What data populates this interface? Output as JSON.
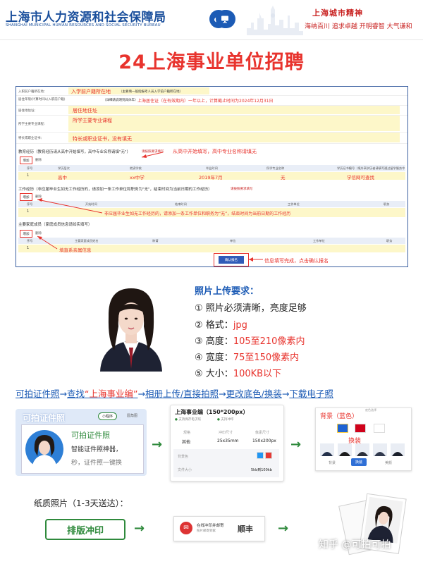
{
  "header": {
    "bureau_name": "上海市人力资源和社会保障局",
    "bureau_name_en": "SHANGHAI MUNICIPAL HUMAN RESOURCES AND SOCIAL SECURITY BUREAU",
    "weibo_icon": "weibo-icon",
    "computer_icon": "computer-icon",
    "spirit_title": "上海城市精神",
    "spirit_slogan": "海纳百川  追求卓越  开明睿智  大气谦和"
  },
  "main_title": "24上海事业单位招聘",
  "form": {
    "labels": {
      "row1": "入职前户籍所在地：",
      "row2": "居住年限(计算时间以入职前户籍)",
      "row3": "居住地住址：",
      "row4": "所学主要专业课程：",
      "row5": "特长或职业证书："
    },
    "hukou_note": "入学前户籍所在地",
    "hukou_small": "（主要填一般指报考人员入学前户籍所在地）",
    "residence_small": "（详细请说明到具体年）",
    "residence_note": "上海居住证（在有效期内）一年以上，计算截止时间为2024年12月31日",
    "address_value": "居住地住址",
    "courses_value": "所学主要专业课程",
    "skills_value": "特长或职业证书，没有填无",
    "education": {
      "heading": "教育经历（教育经历请从高中开始填写，高中专业名称请填\"无\"）",
      "tip": "请按照要求填写",
      "note": "从高中开始填写，高中专业名称请填无",
      "add": "增加",
      "delete": "删除",
      "headers": [
        "序号",
        "学历层次",
        "就读学校",
        "毕业时间",
        "所学专业名称",
        "学历证书编号（境外高学历者请填写通过留学服务中心认证的证书编号）"
      ],
      "row": [
        "1",
        "高中",
        "xx中学",
        "2019年7月",
        "无",
        "学信网可查找"
      ]
    },
    "work": {
      "heading": "工作经历（非应届毕业生如无工作经历的，请添加一条工作单位和职务为\"无\"，结束时间为当前日期的工作经历）",
      "tip": "请按照要求填写",
      "add": "增加",
      "delete": "删除",
      "headers": [
        "序号",
        "开始时间",
        "结束时间",
        "工作单位",
        "职务"
      ],
      "note": "非应届毕业生如无工作经历的，请添加一条工作单位和职务为“无”，结束时间为当前日期的工作经历"
    },
    "family": {
      "heading": "主要家庭成员（家庭成员信息请如实填写）",
      "add": "增加",
      "delete": "删除",
      "headers": [
        "序号",
        "主要家庭成员姓名",
        "称谓",
        "单位",
        "工作单位",
        "职务"
      ],
      "row_num": "1",
      "note": "填直系亲属信息"
    },
    "confirm_button": "确认报名",
    "confirm_note": "信息填写完成，点击确认报名"
  },
  "photo_requirements": {
    "title": "照片上传要求：",
    "items": [
      {
        "num": "①",
        "text": "照片必须清晰，亮度足够",
        "hl": ""
      },
      {
        "num": "②",
        "text": "格式：",
        "hl": "jpg"
      },
      {
        "num": "③",
        "text": "高度：",
        "hl": "105至210像素内"
      },
      {
        "num": "④",
        "text": "宽度：",
        "hl": "75至150像素内"
      },
      {
        "num": "⑤",
        "text": "大小：",
        "hl": "100KB以下"
      }
    ]
  },
  "steps": {
    "s1": "可拍证件照",
    "s2": "查找",
    "s2_q": "“上海事业编”",
    "s3": "相册上传/直接拍照",
    "s4": "更改底色/换装",
    "s5": "下载电子照",
    "arrow": "→"
  },
  "app_card": {
    "name": "可拍证件照",
    "pill": "小程序",
    "other": "圆角图",
    "line1": "可拍证件照",
    "line2": "智能证件照神器，",
    "line3": "秒，证件照一键换"
  },
  "spec_card": {
    "title": "上海事业编（150*200px）",
    "check1": "支持保存电子照",
    "check2": "支持冲印",
    "col1_label": "规格",
    "col2_label": "冲印尺寸",
    "col3_label": "像素尺寸",
    "col1": "其他",
    "col2": "25x35mm",
    "col3": "150x200px",
    "bg_label": "背景色",
    "size_label": "文件大小",
    "size_value": "5kb到100kb",
    "colors": [
      "#2196f3",
      "#e53935",
      "#ffffff"
    ]
  },
  "bg_card": {
    "bg_label": "背景（蓝色）",
    "swap_label": "换装",
    "tab1": "背景",
    "tab2": "换装",
    "tab3": "美颜",
    "top_hint": "底色选择",
    "colors": [
      "#1e63d3",
      "#d0021b",
      "#ffffff"
    ]
  },
  "paper": {
    "title": "纸质照片（1-3天送达）：",
    "print_button": "排版冲印",
    "ship_a": "在线冲印并邮寄",
    "ship_b": "照片邮寄到家",
    "ship_name": "顺丰"
  },
  "watermark": "知乎 @可拍可拍"
}
